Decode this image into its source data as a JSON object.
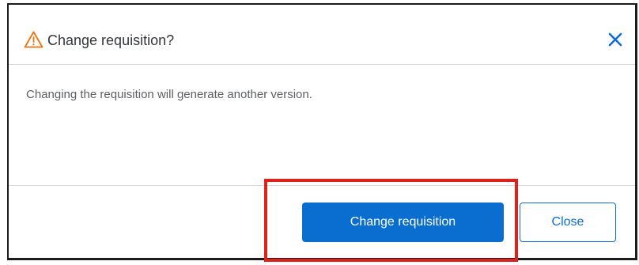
{
  "dialog": {
    "title": "Change requisition?",
    "message": "Changing the requisition will generate another version.",
    "icons": {
      "title_icon": "warning-icon",
      "close_icon": "close-icon"
    },
    "actions": {
      "primary_label": "Change requisition",
      "secondary_label": "Close"
    }
  },
  "colors": {
    "primary_blue": "#0a6ed1",
    "warning_orange": "#e9730c",
    "highlight_red": "#e0201b",
    "title_text": "#32363a",
    "body_text": "#5b5f63"
  }
}
